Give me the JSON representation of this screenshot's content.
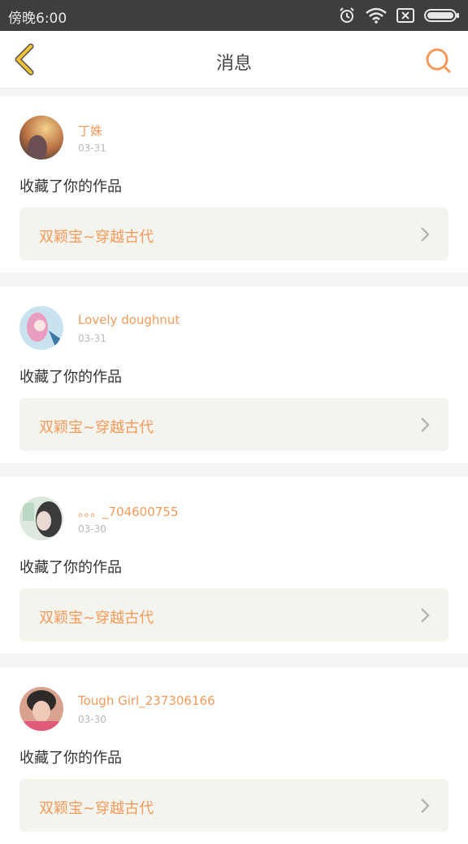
{
  "status": {
    "time": "傍晚6:00"
  },
  "nav": {
    "title": "消息"
  },
  "messages": [
    {
      "user": "丁姝",
      "date": "03-31",
      "action": "收藏了你的作品",
      "work_title": "双颖宝~穿越古代"
    },
    {
      "user": "Lovely doughnut",
      "date": "03-31",
      "action": "收藏了你的作品",
      "work_title": "双颖宝~穿越古代"
    },
    {
      "user": "。。。_704600755",
      "date": "03-30",
      "action": "收藏了你的作品",
      "work_title": "双颖宝~穿越古代"
    },
    {
      "user": "Tough Girl_237306166",
      "date": "03-30",
      "action": "收藏了你的作品",
      "work_title": "双颖宝~穿越古代"
    }
  ],
  "colors": {
    "accent": "#f39a5a",
    "nav_back": "#f1c232",
    "status_bg": "#3e3e3e"
  },
  "icons": [
    "back-chevron-icon",
    "search-icon",
    "alarm-icon",
    "wifi-icon",
    "sim-x-icon",
    "battery-icon",
    "chevron-right-icon"
  ]
}
